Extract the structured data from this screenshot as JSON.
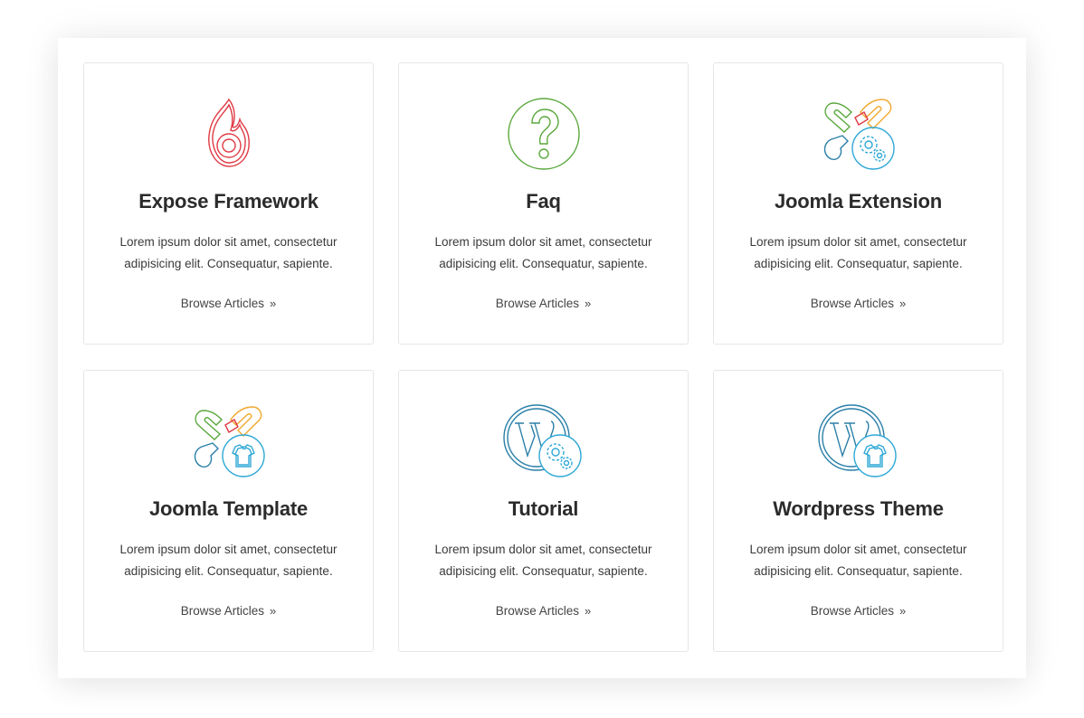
{
  "cards": [
    {
      "title": "Expose Framework",
      "description": "Lorem ipsum dolor sit amet, consectetur adipisicing elit. Consequatur, sapiente.",
      "link": "Browse Articles",
      "icon": "fire-icon",
      "color": "#e03a45"
    },
    {
      "title": "Faq",
      "description": "Lorem ipsum dolor sit amet, consectetur adipisicing elit. Consequatur, sapiente.",
      "link": "Browse Articles",
      "icon": "question-icon",
      "color": "#5aa83c"
    },
    {
      "title": "Joomla Extension",
      "description": "Lorem ipsum dolor sit amet, consectetur adipisicing elit. Consequatur, sapiente.",
      "link": "Browse Articles",
      "icon": "joomla-gears-icon",
      "color": "#2fa8d6"
    },
    {
      "title": "Joomla Template",
      "description": "Lorem ipsum dolor sit amet, consectetur adipisicing elit. Consequatur, sapiente.",
      "link": "Browse Articles",
      "icon": "joomla-shirt-icon",
      "color": "#2fa8d6"
    },
    {
      "title": "Tutorial",
      "description": "Lorem ipsum dolor sit amet, consectetur adipisicing elit. Consequatur, sapiente.",
      "link": "Browse Articles",
      "icon": "wordpress-gears-icon",
      "color": "#2a7fa8"
    },
    {
      "title": "Wordpress Theme",
      "description": "Lorem ipsum dolor sit amet, consectetur adipisicing elit. Consequatur, sapiente.",
      "link": "Browse Articles",
      "icon": "wordpress-shirt-icon",
      "color": "#2a7fa8"
    }
  ],
  "link_chevron": "»"
}
